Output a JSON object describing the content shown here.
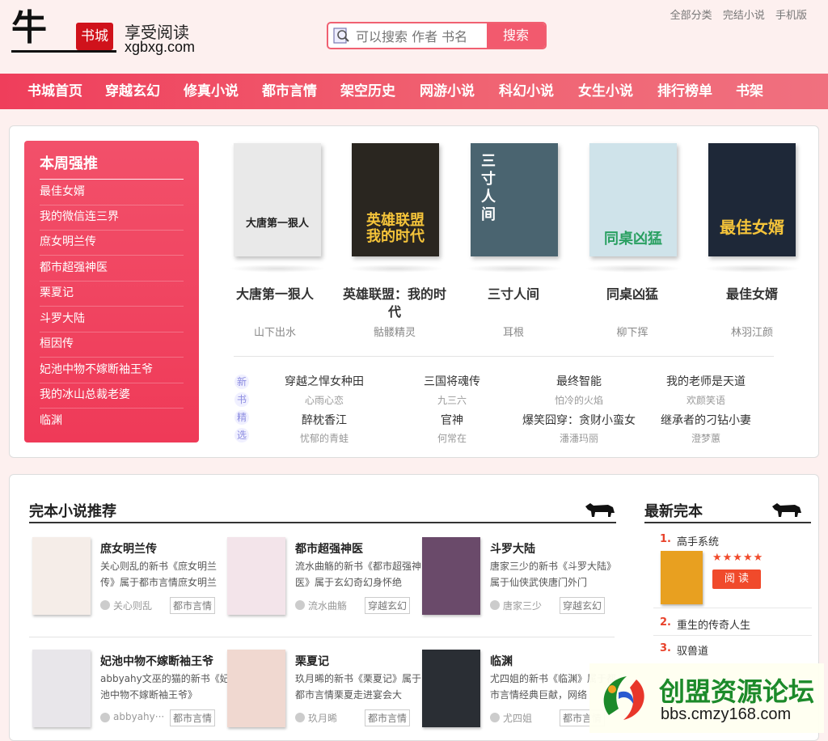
{
  "logo": {
    "char": "牛",
    "stamp": "书城",
    "slogan": "享受阅读",
    "domain": "xgbxg.com"
  },
  "search": {
    "placeholder": "可以搜索 作者 书名",
    "button": "搜索"
  },
  "toplinks": [
    "全部分类",
    "完结小说",
    "手机版"
  ],
  "nav": [
    "书城首页",
    "穿越玄幻",
    "修真小说",
    "都市言情",
    "架空历史",
    "网游小说",
    "科幻小说",
    "女生小说",
    "排行榜单",
    "书架"
  ],
  "weekly": {
    "title": "本周强推",
    "items": [
      "最佳女婿",
      "我的微信连三界",
      "庶女明兰传",
      "都市超强神医",
      "栗夏记",
      "斗罗大陆",
      "桓因传",
      "妃池中物不嫁断袖王爷",
      "我的冰山总裁老婆",
      "临渊"
    ]
  },
  "featured": [
    {
      "title": "大唐第一狠人",
      "author": "山下出水",
      "cover_text": "大唐第一狠人",
      "cover_bg": "#e9e9e9"
    },
    {
      "title": "英雄联盟：我的时代",
      "author": "骷髅精灵",
      "cover_text": "英雄联盟\n我的时代",
      "cover_bg": "#2a2620"
    },
    {
      "title": "三寸人间",
      "author": "耳根",
      "cover_text": "三寸人间",
      "cover_bg": "#4a6470"
    },
    {
      "title": "同桌凶猛",
      "author": "柳下挥",
      "cover_text": "同桌凶猛",
      "cover_bg": "#cfe3ea"
    },
    {
      "title": "最佳女婿",
      "author": "林羽江颜",
      "cover_text": "最佳女婿",
      "cover_bg": "#1e2838"
    }
  ],
  "new_label": [
    "新",
    "书",
    "精",
    "选"
  ],
  "picks": [
    {
      "title": "穿越之悍女种田",
      "author": "心雨心恋"
    },
    {
      "title": "三国将魂传",
      "author": "九三六"
    },
    {
      "title": "最终智能",
      "author": "怕冷的火焰"
    },
    {
      "title": "我的老师是天道",
      "author": "欢颜笑语"
    },
    {
      "title": "醉枕香江",
      "author": "忧郁的青蛙"
    },
    {
      "title": "官神",
      "author": "何常在"
    },
    {
      "title": "爆笑囧穿：贪财小蛮女",
      "author": "潘潘玛丽"
    },
    {
      "title": "继承者的刁钻小妻",
      "author": "澄梦蕙"
    }
  ],
  "complete_section": {
    "title": "完本小说推荐",
    "cards": [
      {
        "title": "庶女明兰传",
        "desc": "关心则乱的新书《庶女明兰传》属于都市言情庶女明兰",
        "author": "关心则乱",
        "tag": "都市言情",
        "cover_bg": "#f5ede8"
      },
      {
        "title": "都市超强神医",
        "desc": "流水曲觞的新书《都市超强神医》属于玄幻奇幻身怀绝",
        "author": "流水曲觞",
        "tag": "穿越玄幻",
        "cover_bg": "#f3e4ea"
      },
      {
        "title": "斗罗大陆",
        "desc": "唐家三少的新书《斗罗大陆》属于仙侠武侠唐门外门",
        "author": "唐家三少",
        "tag": "穿越玄幻",
        "cover_bg": "#6a4a6a"
      },
      {
        "title": "妃池中物不嫁断袖王爷",
        "desc": "abbyahy文巫的猫的新书《妃池中物不嫁断袖王爷》",
        "author": "abbyahy···",
        "tag": "都市言情",
        "cover_bg": "#e8e6ea"
      },
      {
        "title": "栗夏记",
        "desc": "玖月晞的新书《栗夏记》属于都市言情栗夏走进宴会大",
        "author": "玖月晞",
        "tag": "都市言情",
        "cover_bg": "#f0d8d0"
      },
      {
        "title": "临渊",
        "desc": "尤四姐的新书《临渊》属于都市言情经典巨献，网络",
        "author": "尤四姐",
        "tag": "都市言情",
        "cover_bg": "#2a2e34"
      }
    ]
  },
  "latest_section": {
    "title": "最新完本",
    "items": [
      {
        "num": "1.",
        "title": "高手系统"
      },
      {
        "num": "2.",
        "title": "重生的传奇人生"
      },
      {
        "num": "3.",
        "title": "驭兽道"
      }
    ],
    "stars": "★★★★★",
    "read": "阅 读",
    "cover_bg": "#e8a020"
  },
  "watermark": {
    "text": "创盟资源论坛",
    "domain": "bbs.cmzy168.com"
  },
  "colors": {
    "accent": "#f25a6e",
    "nav": "#ef4a62",
    "orange": "#f04a2b"
  }
}
